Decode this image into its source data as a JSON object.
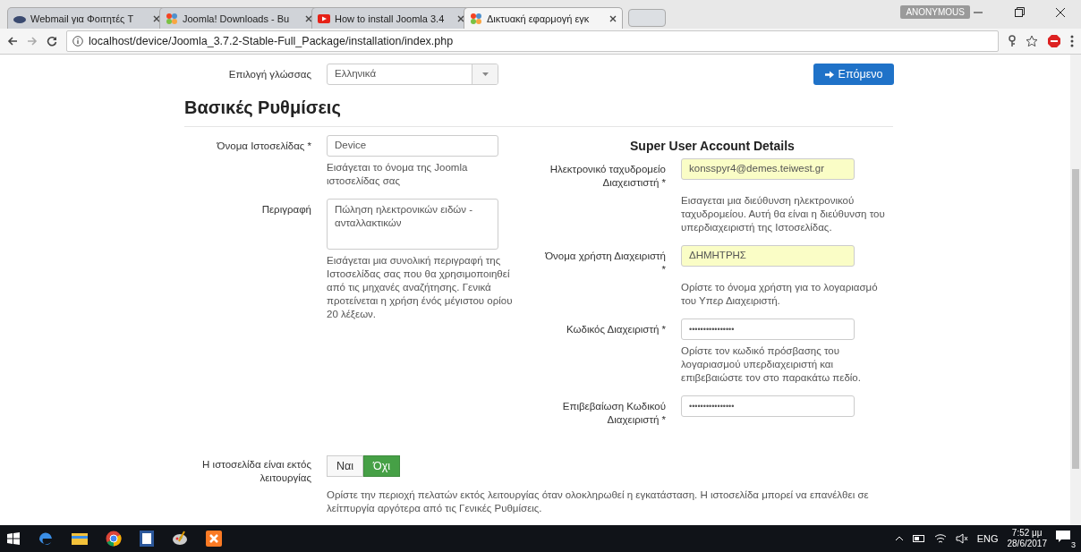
{
  "browser": {
    "tabs": [
      {
        "title": "Webmail για Φοιτητές T",
        "selected": false
      },
      {
        "title": "Joomla! Downloads - Bu",
        "selected": false
      },
      {
        "title": "How to install Joomla 3.4",
        "selected": false
      },
      {
        "title": "Δικτυακή εφαρμογή εγκ",
        "selected": true
      }
    ],
    "profile": "ANONYMOUS",
    "url": "localhost/device/Joomla_3.7.2-Stable-Full_Package/installation/index.php"
  },
  "language": {
    "label": "Επιλογή γλώσσας",
    "value": "Ελληνικά"
  },
  "next_button": "Επόμενο",
  "heading": "Βασικές Ρυθμίσεις",
  "left_fields": [
    {
      "label": "Όνομα Ιστοσελίδας *",
      "kind": "text",
      "value": "Device",
      "autofilled": false,
      "help": "Εισάγεται το όνομα της Joomla ιστοσελίδας σας"
    },
    {
      "label": "Περιγραφή",
      "kind": "textarea",
      "value": "Πώληση ηλεκτρονικών ειδών - ανταλλακτικών",
      "autofilled": false,
      "help": "Εισάγεται μια συνολική περιγραφή της Ιστοσελίδας σας που θα χρησιμοποιηθεί από τις μηχανές αναζήτησης. Γενικά προτείνεται η χρήση ένός μέγιστου ορίου 20 λέξεων."
    }
  ],
  "super_user": {
    "title": "Super User Account Details",
    "fields": [
      {
        "label": "Ηλεκτρονικό ταχυδρομείο Διαχειστιστή *",
        "kind": "text",
        "value": "konsspyr4@demes.teiwest.gr",
        "autofilled": true,
        "help": "Εισαγεται μια διεύθυνση ηλεκτρονικού ταχυδρομείου. Αυτή θα είναι η διεύθυνση του υπερδιαχειριστή της Ιστοσελίδας."
      },
      {
        "label": "Όνομα χρήστη Διαχειριστή *",
        "kind": "text",
        "value": "ΔΗΜΗΤΡΗΣ",
        "autofilled": true,
        "help": "Ορίστε το όνομα χρήστη για το λογαριασμό του Υπερ Διαχειριστή."
      },
      {
        "label": "Κωδικός Διαχειριστή *",
        "kind": "password",
        "value": "••••••••••••••••",
        "autofilled": false,
        "help": "Ορίστε τον κωδικό πρόσβασης του λογαριασμού υπερδιαχειριστή και επιβεβαιώστε τον στο παρακάτω πεδίο."
      },
      {
        "label": "Επιβεβαίωση Κωδικού Διαχειριστή *",
        "kind": "password",
        "value": "••••••••••••••••",
        "autofilled": false
      }
    ]
  },
  "offline": {
    "label": "Η ιστοσελίδα είναι εκτός λειτουργίας",
    "options": [
      {
        "label": "Ναι",
        "selected": false
      },
      {
        "label": "Όχι",
        "selected": true
      }
    ],
    "help": "Ορίστε την περιοχή πελατών εκτός λειτουργίας όταν ολοκληρωθεί η εγκατάσταση. Η ιστοσελίδα μπορεί να επανέλθει σε λείτπυργία αργότερα από τις Γενικές Ρυθμίσεις."
  },
  "taskbar": {
    "language": "ENG",
    "time": "7:52 μμ",
    "date": "28/6/2017",
    "notifications": "3"
  }
}
